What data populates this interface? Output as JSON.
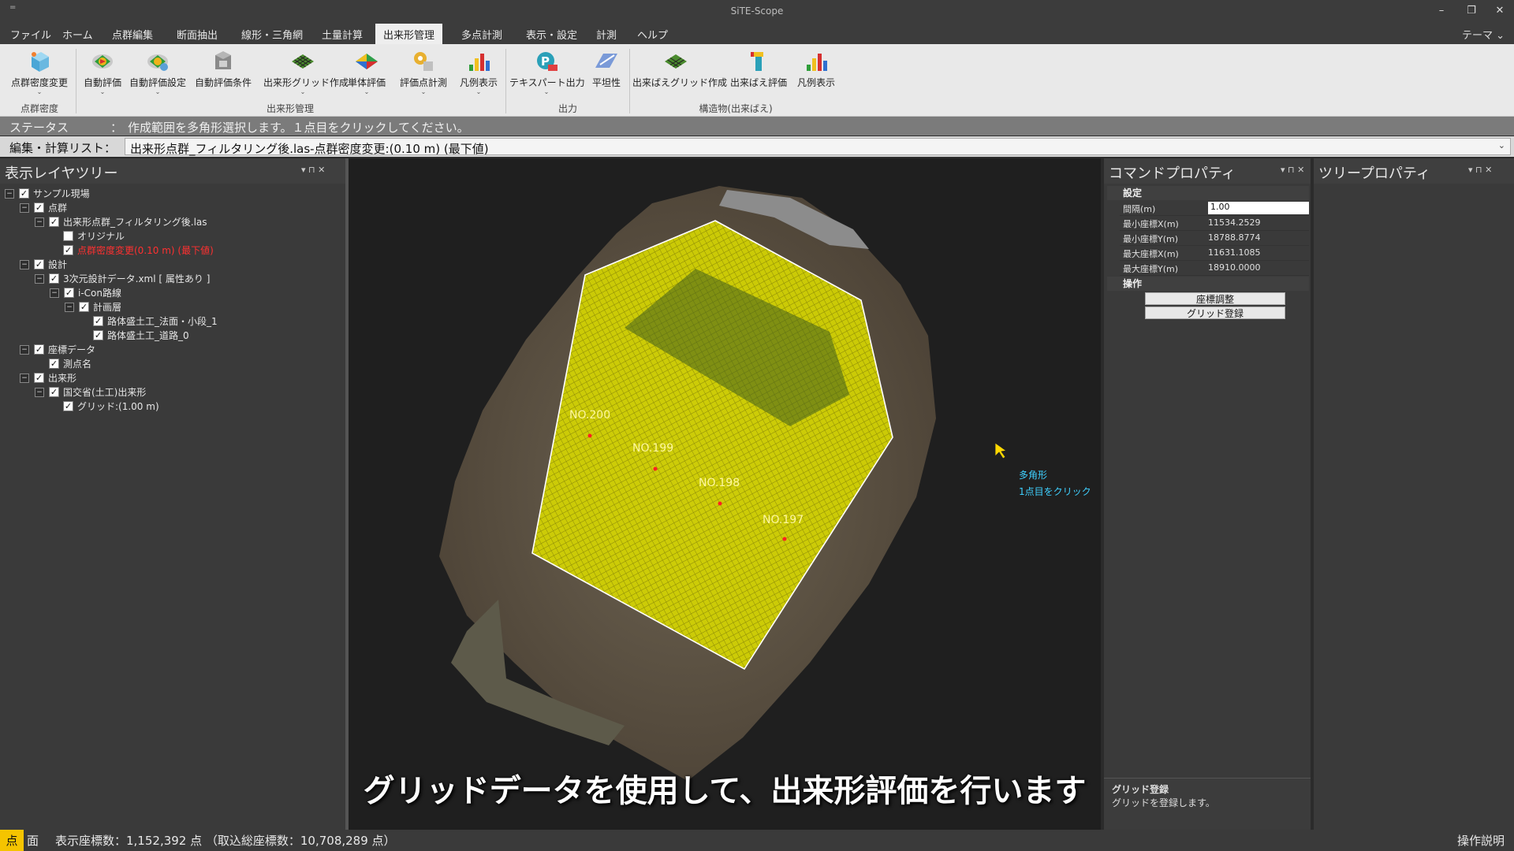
{
  "window": {
    "title": "SiTE-Scope",
    "sys_menu": "=",
    "min": "–",
    "restore": "❐",
    "close": "✕"
  },
  "menubar": {
    "items": [
      "ファイル",
      "ホーム",
      "点群編集",
      "断面抽出",
      "線形・三角網",
      "土量計算",
      "出来形管理",
      "多点計測",
      "表示・設定",
      "計測",
      "ヘルプ"
    ],
    "active": "出来形管理",
    "theme": "テーマ ⌄"
  },
  "ribbon": {
    "groups": {
      "density": "点群密度",
      "dekigata": "出来形管理",
      "output": "出力",
      "structure": "構造物(出来ばえ)"
    },
    "buttons": {
      "density_change": "点群密度変更",
      "auto_eval": "自動評価",
      "auto_eval_setting": "自動評価設定",
      "auto_eval_cond": "自動評価条件",
      "grid_create": "出来形グリッド作成",
      "single_eval": "単体評価",
      "eval_point": "評価点計測",
      "legend": "凡例表示",
      "text_export": "テキスパート出力",
      "flatness": "平坦性",
      "deki_grid": "出来ばえグリッド作成",
      "deki_eval": "出来ばえ評価",
      "legend2": "凡例表示"
    },
    "colors": {
      "accent": "#dcdcdc"
    }
  },
  "status": {
    "label": "ステータス",
    "sep": "：",
    "message": "作成範囲を多角形選択します。１点目をクリックしてください。"
  },
  "editlist": {
    "label": "編集・計算リスト：",
    "value": "出来形点群_フィルタリング後.las-点群密度変更:(0.10 m) (最下値)"
  },
  "layer_tree": {
    "title": "表示レイヤツリー",
    "nodes": {
      "site": "サンプル現場",
      "pointcloud": "点群",
      "las": "出来形点群_フィルタリング後.las",
      "original": "オリジナル",
      "density": "点群密度変更(0.10 m) (最下値)",
      "design": "設計",
      "xml": "3次元設計データ.xml [ 属性あり ]",
      "icon_route": "i-Con路線",
      "plan_layer": "計画層",
      "slope": "路体盛土工_法面・小段_1",
      "road": "路体盛土工_道路_0",
      "coord": "座標データ",
      "station": "測点名",
      "dekigata": "出来形",
      "mlit": "国交省(土工)出来形",
      "grid": "グリッド:(1.00 m)"
    },
    "collapse_sign": "−",
    "check_sign": "✓"
  },
  "viewport": {
    "stations": [
      "NO.200",
      "NO.199",
      "NO.198",
      "NO.197"
    ],
    "hint_line1": "多角形",
    "hint_line2": "1点目をクリック",
    "subtitle": "グリッドデータを使用して、出来形評価を行います",
    "colors": {
      "grid_fill": "#e6e600",
      "outline": "#ffffff",
      "bg": "#1f1f1f",
      "ground": "#6b5c48"
    }
  },
  "command_props": {
    "title": "コマンドプロパティ",
    "section_settings": "設定",
    "rows": [
      {
        "key": "間隔(m)",
        "value": "1.00"
      },
      {
        "key": "最小座標X(m)",
        "value": "11534.2529"
      },
      {
        "key": "最小座標Y(m)",
        "value": "18788.8774"
      },
      {
        "key": "最大座標X(m)",
        "value": "11631.1085"
      },
      {
        "key": "最大座標Y(m)",
        "value": "18910.0000"
      }
    ],
    "section_ops": "操作",
    "btn_adjust": "座標調整",
    "btn_register": "グリッド登録",
    "desc_line1": "グリッド登録",
    "desc_line2": "グリッドを登録します。"
  },
  "tree_props": {
    "title": "ツリープロパティ"
  },
  "panel_buttons": "▾  ⊓  ✕",
  "bottom": {
    "mode_point": "点",
    "mode_face": "面",
    "coord_count": "表示座標数：1,152,392 点 （取込総座標数：10,708,289 点）",
    "op_help": "操作説明"
  }
}
